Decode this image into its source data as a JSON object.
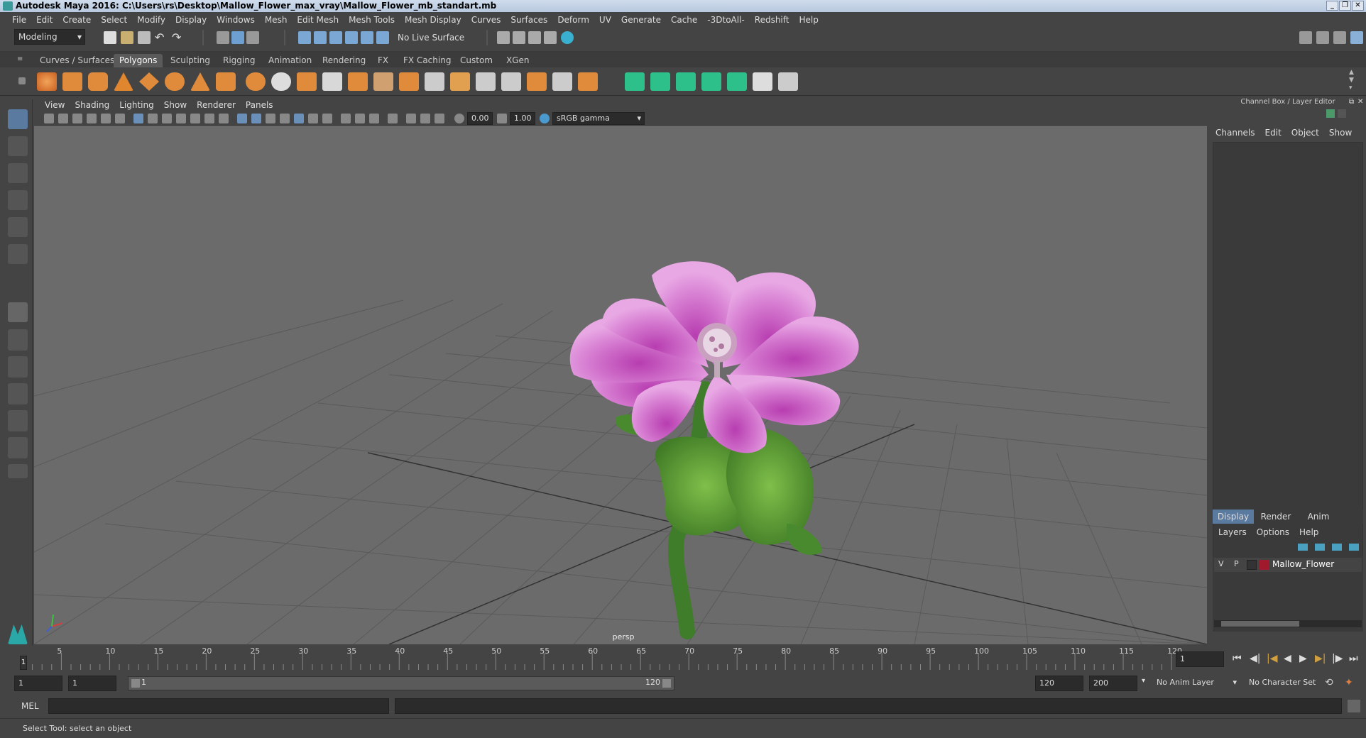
{
  "window": {
    "title": "Autodesk Maya 2016: C:\\Users\\rs\\Desktop\\Mallow_Flower_max_vray\\Mallow_Flower_mb_standart.mb"
  },
  "menubar": {
    "items": [
      "File",
      "Edit",
      "Create",
      "Select",
      "Modify",
      "Display",
      "Windows",
      "Mesh",
      "Edit Mesh",
      "Mesh Tools",
      "Mesh Display",
      "Curves",
      "Surfaces",
      "Deform",
      "UV",
      "Generate",
      "Cache",
      "-3DtoAll-",
      "Redshift",
      "Help"
    ]
  },
  "statusline": {
    "mode": "Modeling",
    "live_surface": "No Live Surface"
  },
  "shelf": {
    "tabs": [
      "Curves / Surfaces",
      "Polygons",
      "Sculpting",
      "Rigging",
      "Animation",
      "Rendering",
      "FX",
      "FX Caching",
      "Custom",
      "XGen"
    ],
    "active_tab": "Polygons"
  },
  "viewport": {
    "menu": [
      "View",
      "Shading",
      "Lighting",
      "Show",
      "Renderer",
      "Panels"
    ],
    "exposure": "0.00",
    "gamma": "1.00",
    "color_space": "sRGB gamma",
    "camera_label": "persp"
  },
  "channelbox": {
    "title": "Channel Box / Layer Editor",
    "menu": [
      "Channels",
      "Edit",
      "Object",
      "Show"
    ]
  },
  "layereditor": {
    "tabs": [
      "Display",
      "Render",
      "Anim"
    ],
    "active_tab": "Display",
    "menu": [
      "Layers",
      "Options",
      "Help"
    ],
    "layer": {
      "v": "V",
      "p": "P",
      "name": "Mallow_Flower",
      "color": "#a0192d"
    }
  },
  "timeline": {
    "ticks": [
      "5",
      "10",
      "15",
      "20",
      "25",
      "30",
      "35",
      "40",
      "45",
      "50",
      "55",
      "60",
      "65",
      "70",
      "75",
      "80",
      "85",
      "90",
      "95",
      "100",
      "105",
      "110",
      "115",
      "120"
    ],
    "current_frame_marker": "1",
    "current_frame": "1"
  },
  "range": {
    "start": "1",
    "playback_start": "1",
    "slider_start": "1",
    "slider_end": "120",
    "playback_end": "120",
    "end": "200",
    "anim_layer": "No Anim Layer",
    "character_set": "No Character Set"
  },
  "cmdline": {
    "label": "MEL"
  },
  "helpline": {
    "text": "Select Tool: select an object"
  }
}
